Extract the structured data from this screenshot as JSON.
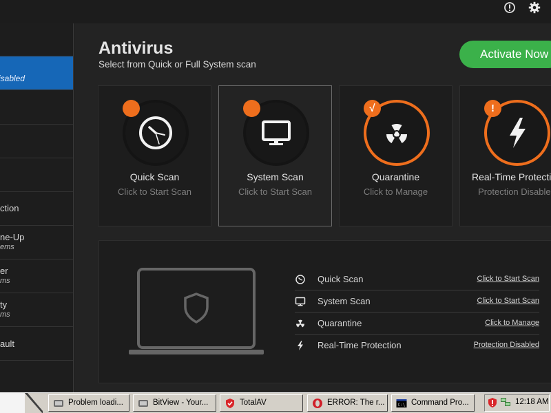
{
  "header": {
    "icons": [
      "info-icon",
      "gear-icon"
    ]
  },
  "sidebar": {
    "items": [
      {
        "line1": "",
        "line2": ""
      },
      {
        "line1": "isabled",
        "line2": "",
        "active": true
      },
      {
        "line1": "",
        "line2": ""
      },
      {
        "line1": "",
        "line2": ""
      },
      {
        "line1": "",
        "line2": ""
      },
      {
        "line1": "ction",
        "line2": ""
      },
      {
        "line1": "ne-Up",
        "line2": "ems"
      },
      {
        "line1": "er",
        "line2": "ms"
      },
      {
        "line1": "ty",
        "line2": "ms"
      },
      {
        "line1": "ault",
        "line2": ""
      }
    ]
  },
  "main": {
    "title": "Antivirus",
    "subtitle": "Select from Quick or Full System scan",
    "activate_label": "Activate Now",
    "cards": [
      {
        "name": "Quick Scan",
        "sub": "Click to Start Scan",
        "badge": "",
        "icon": "clock-icon"
      },
      {
        "name": "System Scan",
        "sub": "Click to Start Scan",
        "badge": "",
        "icon": "monitor-icon"
      },
      {
        "name": "Quarantine",
        "sub": "Click to Manage",
        "badge": "√",
        "icon": "radiation-icon"
      },
      {
        "name": "Real-Time Protection",
        "sub": "Protection Disabled",
        "badge": "!",
        "icon": "lightning-icon"
      }
    ],
    "status_rows": [
      {
        "name": "Quick Scan",
        "link": "Click to Start Scan",
        "icon": "clock-icon"
      },
      {
        "name": "System Scan",
        "link": "Click to Start Scan",
        "icon": "monitor-icon"
      },
      {
        "name": "Quarantine",
        "link": "Click to Manage",
        "icon": "radiation-icon"
      },
      {
        "name": "Real-Time Protection",
        "link": "Protection Disabled",
        "icon": "lightning-icon"
      }
    ]
  },
  "taskbar": {
    "tasks": [
      {
        "label": "Problem loadi...",
        "icon": "bitview-icon"
      },
      {
        "label": "BitView - Your...",
        "icon": "bitview-icon"
      },
      {
        "label": "TotalAV",
        "icon": "totalav-icon"
      },
      {
        "label": "ERROR: The r...",
        "icon": "opera-icon"
      },
      {
        "label": "Command Pro...",
        "icon": "cmd-icon"
      }
    ],
    "clock": "12:18 AM"
  },
  "colors": {
    "accent_blue": "#1667b7",
    "activate_green": "#3bb14a",
    "warning_orange": "#ee6e1d",
    "background": "#232323"
  }
}
